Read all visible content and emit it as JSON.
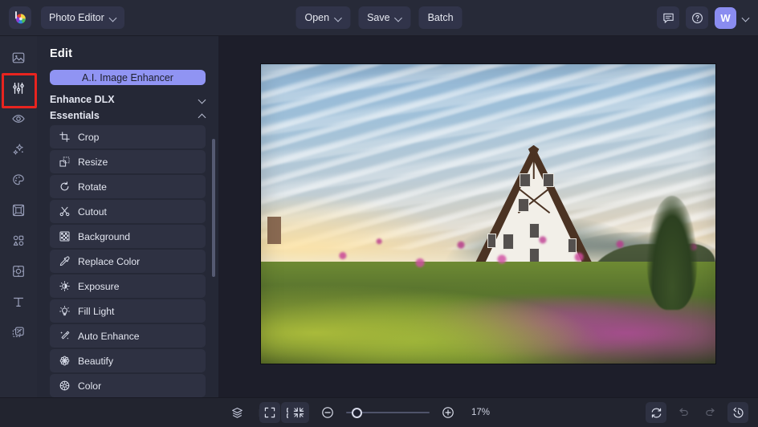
{
  "app": {
    "logo_icon": "color-wheel-logo",
    "title": "Photo Editor",
    "title_chevron": "chevron-down-icon"
  },
  "topbar": {
    "buttons": [
      {
        "label": "Open",
        "icon": "chevron-down-icon",
        "has_chevron": true
      },
      {
        "label": "Save",
        "icon": "chevron-down-icon",
        "has_chevron": true
      },
      {
        "label": "Batch",
        "icon": "",
        "has_chevron": false
      }
    ],
    "right": {
      "feedback_icon": "comment-icon",
      "help_icon": "question-circle-icon",
      "avatar_initial": "W",
      "avatar_chevron": "chevron-down-icon",
      "avatar_color": "#8a8cf0"
    }
  },
  "rail": {
    "items": [
      {
        "name": "image",
        "icon": "image-icon",
        "active": false
      },
      {
        "name": "adjust",
        "icon": "sliders-icon",
        "active": true
      },
      {
        "name": "retouch",
        "icon": "eye-icon",
        "active": false
      },
      {
        "name": "effects",
        "icon": "sparkles-icon",
        "active": false
      },
      {
        "name": "paint",
        "icon": "palette-icon",
        "active": false
      },
      {
        "name": "frames",
        "icon": "frame-icon",
        "active": false
      },
      {
        "name": "shapes",
        "icon": "shapes-icon",
        "active": false
      },
      {
        "name": "transform",
        "icon": "transform-icon",
        "active": false
      },
      {
        "name": "text",
        "icon": "text-icon",
        "active": false
      },
      {
        "name": "layers",
        "icon": "layers-stack-icon",
        "active": false
      }
    ],
    "highlight_color": "#e8241f"
  },
  "panel": {
    "heading": "Edit",
    "ai_button": {
      "label": "A.I. Image Enhancer",
      "color": "#9094f3"
    },
    "sections": [
      {
        "label": "Enhance DLX",
        "expanded": false,
        "chevron": "chevron-down-icon"
      },
      {
        "label": "Essentials",
        "expanded": true,
        "chevron": "chevron-up-icon"
      }
    ],
    "tools": [
      {
        "label": "Crop",
        "icon": "crop-icon"
      },
      {
        "label": "Resize",
        "icon": "resize-icon"
      },
      {
        "label": "Rotate",
        "icon": "rotate-icon"
      },
      {
        "label": "Cutout",
        "icon": "scissors-icon"
      },
      {
        "label": "Background",
        "icon": "checkerboard-icon"
      },
      {
        "label": "Replace Color",
        "icon": "eyedropper-icon"
      },
      {
        "label": "Exposure",
        "icon": "exposure-icon"
      },
      {
        "label": "Fill Light",
        "icon": "lightbulb-icon"
      },
      {
        "label": "Auto Enhance",
        "icon": "magic-wand-icon"
      },
      {
        "label": "Beautify",
        "icon": "flower-icon"
      },
      {
        "label": "Color",
        "icon": "color-wheel-icon"
      }
    ]
  },
  "canvas": {
    "image_description": "A-frame white house at sunrise with mountains, mist and a flower garden"
  },
  "bottombar": {
    "left_tools": [
      {
        "name": "layers",
        "icon": "layers-icon"
      },
      {
        "name": "compare",
        "icon": "compare-icon"
      },
      {
        "name": "grid",
        "icon": "grid-icon"
      }
    ],
    "view_tools": [
      {
        "name": "fullscreen",
        "icon": "expand-icon"
      },
      {
        "name": "fit-screen",
        "icon": "collapse-icon"
      }
    ],
    "zoom_out_icon": "minus-circle-icon",
    "zoom_in_icon": "plus-circle-icon",
    "zoom_level": "17%",
    "zoom_slider_percent": 8,
    "right_tools": [
      {
        "name": "reset",
        "icon": "reset-icon",
        "enabled": true
      },
      {
        "name": "undo",
        "icon": "undo-icon",
        "enabled": false
      },
      {
        "name": "redo",
        "icon": "redo-icon",
        "enabled": false
      },
      {
        "name": "history",
        "icon": "history-icon",
        "enabled": true
      }
    ]
  }
}
